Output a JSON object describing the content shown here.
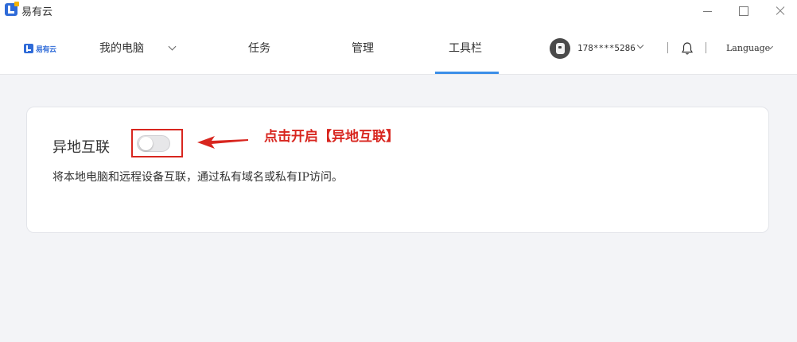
{
  "window": {
    "title": "易有云",
    "min_icon": "minimize-icon",
    "max_icon": "maximize-icon",
    "close_icon": "close-icon"
  },
  "nav": {
    "logo_text": "易有云",
    "my_computer": "我的电脑",
    "tasks": "任务",
    "manage": "管理",
    "toolbar": "工具栏",
    "active_tab": "工具栏",
    "accent_color": "#3b8ee8"
  },
  "user": {
    "phone": "178****5286",
    "language": "Language"
  },
  "card": {
    "title": "异地互联",
    "toggle_on": false,
    "annotation": "点击开启【异地互联】",
    "annotation_color": "#d8261f",
    "description": "将本地电脑和远程设备互联，通过私有域名或私有IP访问。"
  }
}
